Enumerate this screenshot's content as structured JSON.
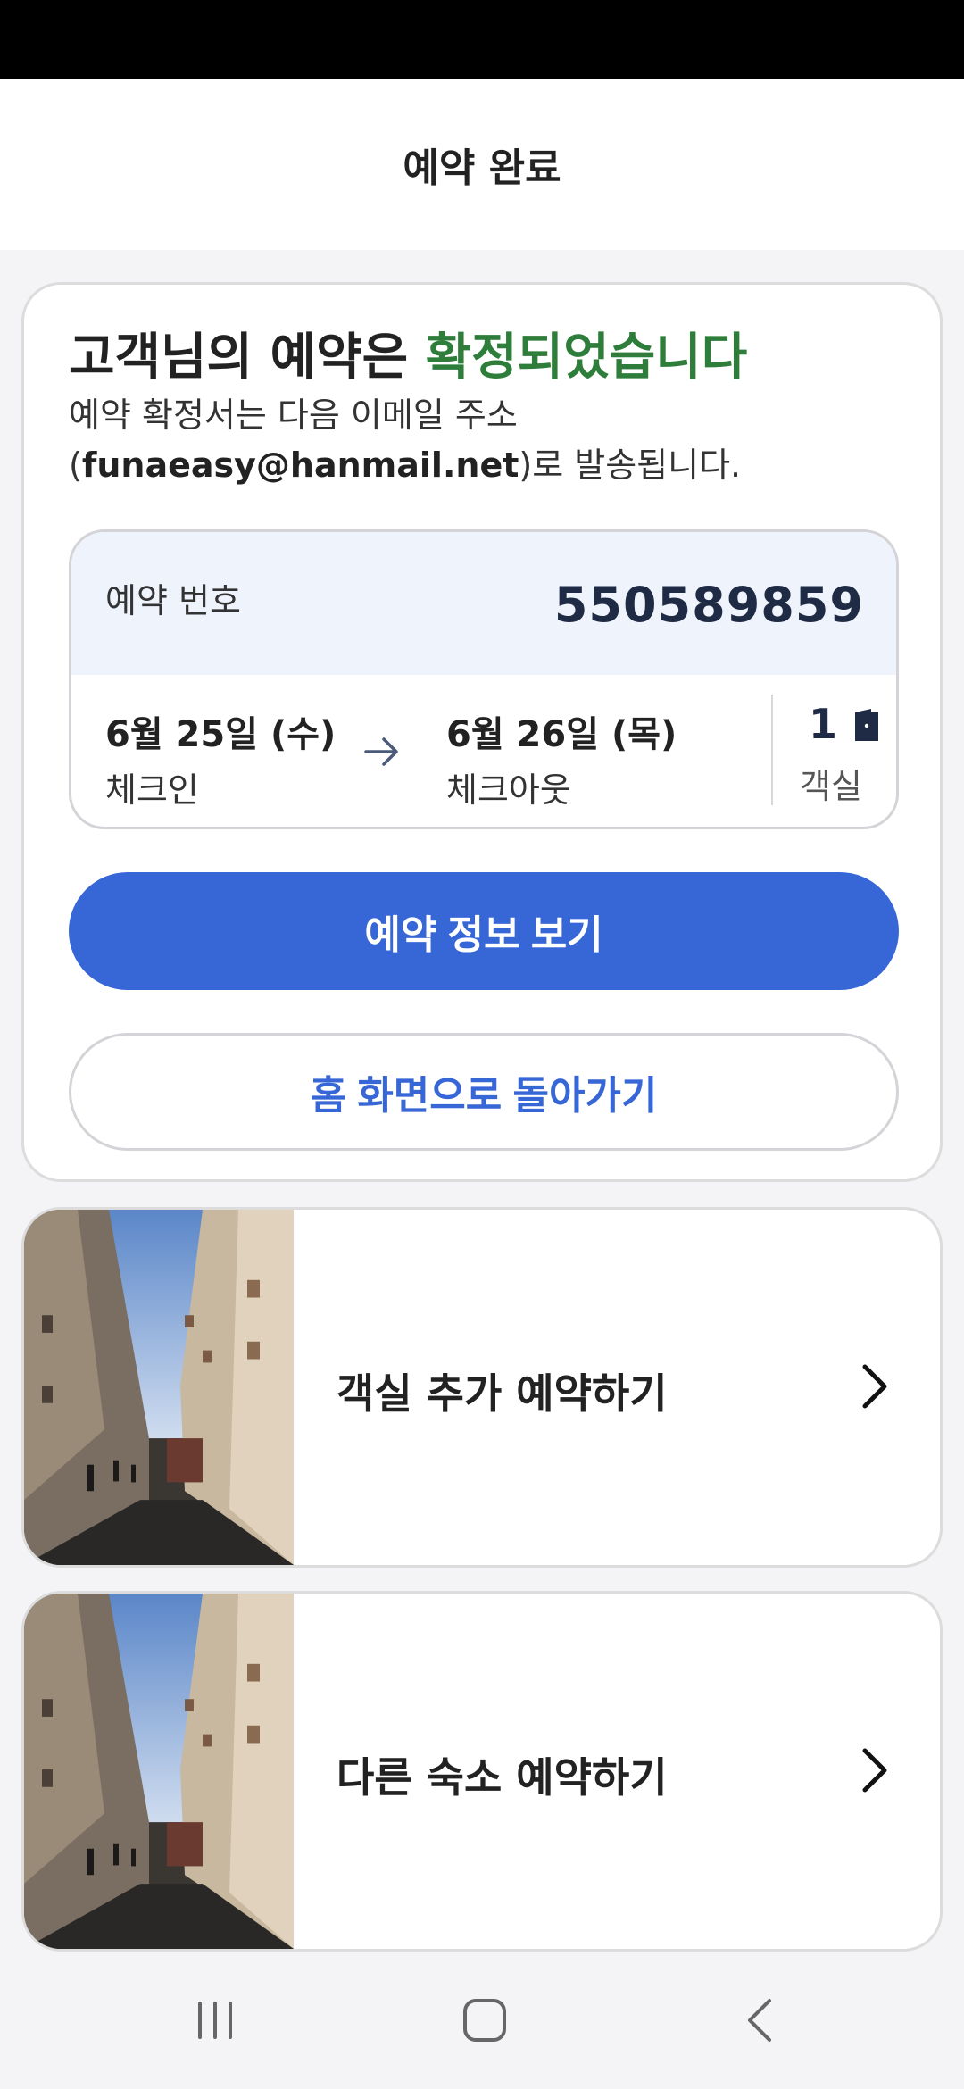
{
  "header": {
    "title": "예약 완료"
  },
  "confirmation": {
    "headline_prefix": "고객님의 예약은 ",
    "headline_accent": "확정되었습니다",
    "accent_color": "#2e7d3a",
    "notice_line1": "예약 확정서는 다음 이메일 주소",
    "notice_open": "(",
    "email": "funaeasy@hanmail.net",
    "notice_close": ")로 발송됩니다."
  },
  "booking": {
    "number_label": "예약 번호",
    "number": "550589859",
    "checkin_date": "6월 25일 (수)",
    "checkin_label": "체크인",
    "checkout_date": "6월 26일 (목)",
    "checkout_label": "체크아웃",
    "room_count": "1",
    "room_label": "객실"
  },
  "buttons": {
    "view_booking": "예약 정보 보기",
    "go_home": "홈 화면으로 돌아가기"
  },
  "promos": [
    {
      "label": "객실 추가 예약하기",
      "icon": "chevron-right-icon"
    },
    {
      "label": "다른 숙소 예약하기",
      "icon": "chevron-right-icon"
    }
  ],
  "colors": {
    "primary": "#3766d6",
    "booking_bg": "#eef3fc"
  },
  "nav": {
    "icons": [
      "recent-apps-icon",
      "home-icon",
      "back-icon"
    ]
  }
}
